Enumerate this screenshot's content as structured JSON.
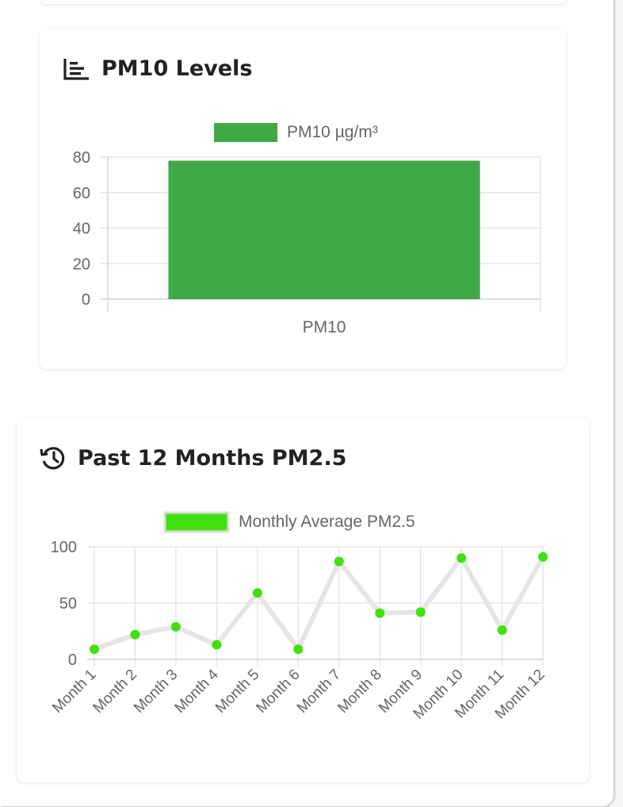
{
  "pm10_card": {
    "title": "PM10 Levels",
    "icon": "bar-chart-icon"
  },
  "history_card": {
    "title": "Past 12 Months PM2.5",
    "icon": "history-icon"
  },
  "colors": {
    "pm10_bar": "#41a846",
    "pm25_point": "#3fe10d",
    "pm25_line": "#e5e5e5"
  },
  "chart_data": [
    {
      "type": "bar",
      "categories": [
        "PM10"
      ],
      "series": [
        {
          "name": "PM10 µg/m³",
          "values": [
            78
          ]
        }
      ],
      "ylim": [
        0,
        80
      ],
      "yticks": [
        0,
        20,
        40,
        60,
        80
      ],
      "grid": true,
      "legend": "top-center"
    },
    {
      "type": "line",
      "categories": [
        "Month 1",
        "Month 2",
        "Month 3",
        "Month 4",
        "Month 5",
        "Month 6",
        "Month 7",
        "Month 8",
        "Month 9",
        "Month 10",
        "Month 11",
        "Month 12"
      ],
      "series": [
        {
          "name": "Monthly Average PM2.5",
          "values": [
            9,
            22,
            29,
            13,
            59,
            9,
            87,
            41,
            42,
            90,
            26,
            91
          ]
        }
      ],
      "ylim": [
        0,
        100
      ],
      "yticks": [
        0,
        50,
        100
      ],
      "grid": true,
      "legend": "top-center"
    }
  ]
}
